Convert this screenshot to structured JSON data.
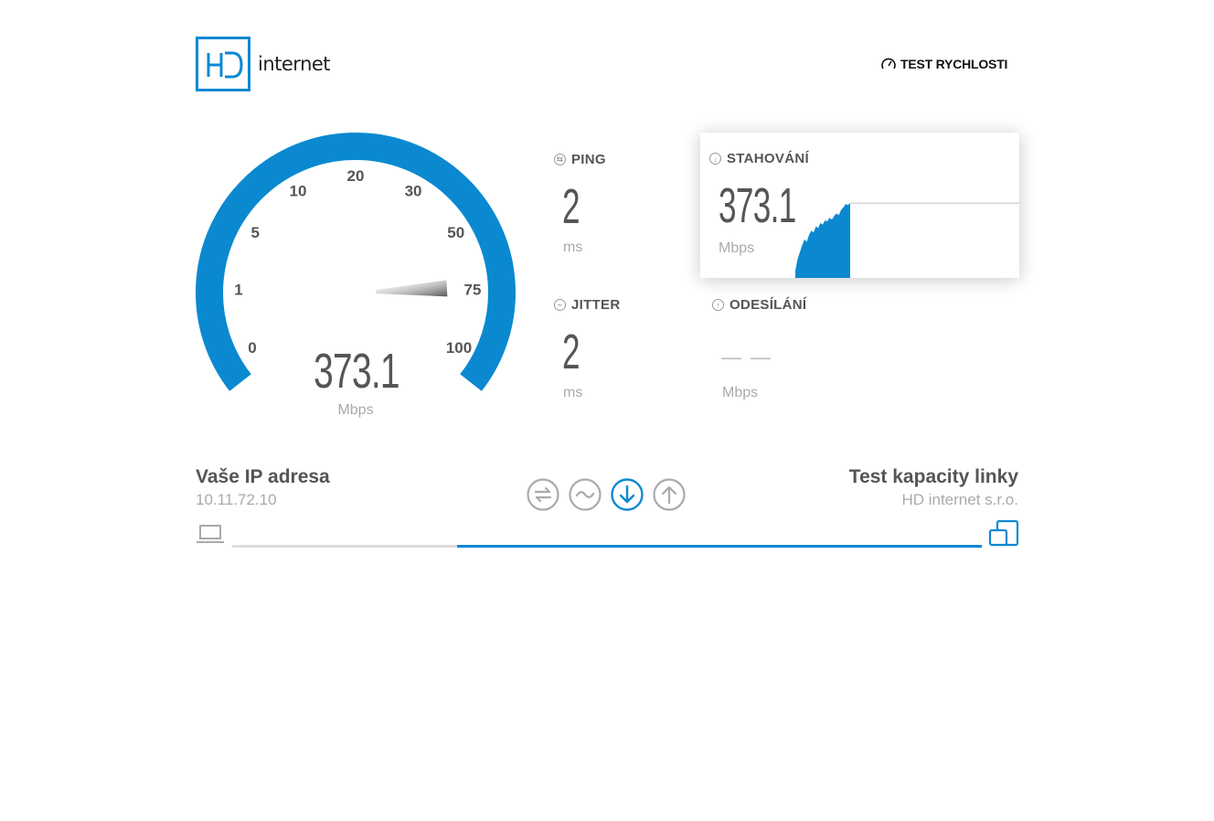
{
  "header": {
    "brand_text": "internet",
    "nav_test_label": "TEST RYCHLOSTI"
  },
  "gauge": {
    "ticks": [
      "0",
      "1",
      "5",
      "10",
      "20",
      "30",
      "50",
      "75",
      "100"
    ],
    "value": "373.1",
    "unit": "Mbps",
    "needle_fraction": 0.87,
    "accent_color": "#0a89d1"
  },
  "ping": {
    "label": "PING",
    "value": "2",
    "unit": "ms",
    "icon": "ping-icon"
  },
  "jitter": {
    "label": "JITTER",
    "value": "2",
    "unit": "ms",
    "icon": "jitter-icon"
  },
  "download": {
    "label": "STAHOVÁNÍ",
    "value": "373.1",
    "unit": "Mbps",
    "icon": "download-icon",
    "samples": [
      0.08,
      0.22,
      0.3,
      0.38,
      0.45,
      0.42,
      0.5,
      0.55,
      0.53,
      0.6,
      0.58,
      0.64,
      0.62,
      0.67,
      0.66,
      0.7,
      0.68,
      0.72,
      0.75,
      0.73,
      0.79,
      0.82,
      0.86,
      0.85,
      0.87
    ]
  },
  "upload": {
    "label": "ODESÍLÁNÍ",
    "value": "— —",
    "unit": "Mbps",
    "icon": "upload-icon"
  },
  "client": {
    "title": "Vaše IP adresa",
    "ip": "10.11.72.10"
  },
  "server": {
    "title": "Test kapacity linky",
    "name": "HD internet s.r.o."
  },
  "steps": [
    {
      "name": "ping-step-icon",
      "active": false
    },
    {
      "name": "jitter-step-icon",
      "active": false
    },
    {
      "name": "download-step-icon",
      "active": true
    },
    {
      "name": "upload-step-icon",
      "active": false
    }
  ],
  "progress": {
    "fraction": 0.3
  }
}
